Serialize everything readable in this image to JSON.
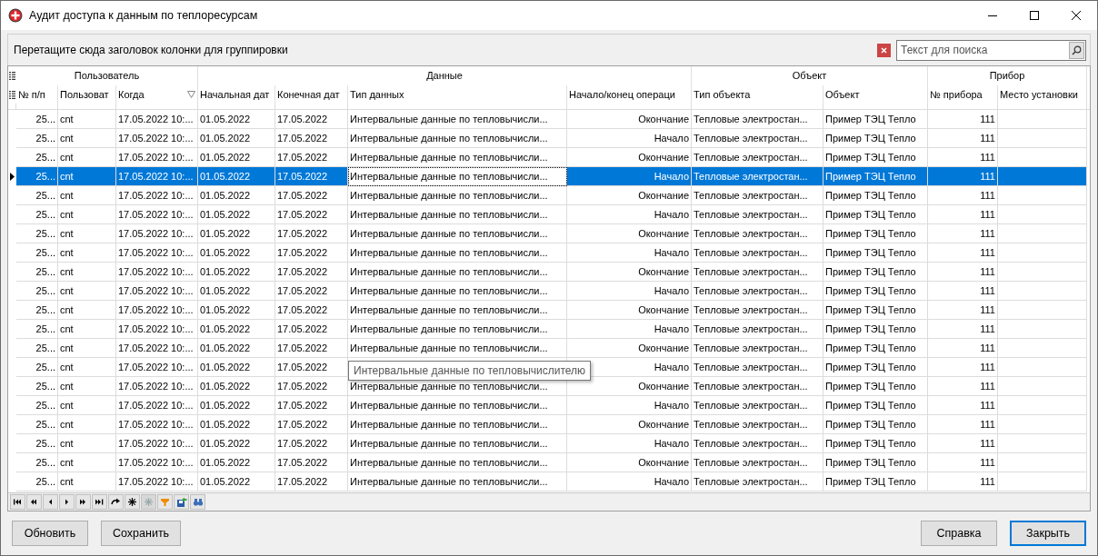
{
  "window": {
    "title": "Аудит доступа к данным по теплоресурсам"
  },
  "group_panel": {
    "hint": "Перетащите сюда заголовок колонки для группировки",
    "search": {
      "placeholder": "Текст для поиска"
    }
  },
  "table": {
    "bands": [
      {
        "label": "Пользователь",
        "columns": [
          {
            "label": "№ п/п",
            "filtered": false
          },
          {
            "label": "Пользоват",
            "filtered": false
          },
          {
            "label": "Когда",
            "filtered": true
          }
        ]
      },
      {
        "label": "Данные",
        "columns": [
          {
            "label": "Начальная дат",
            "filtered": false
          },
          {
            "label": "Конечная дат",
            "filtered": false
          },
          {
            "label": "Тип данных",
            "filtered": false
          },
          {
            "label": "Начало/конец операци",
            "filtered": false
          }
        ]
      },
      {
        "label": "Объект",
        "columns": [
          {
            "label": "Тип объекта",
            "filtered": false
          },
          {
            "label": "Объект",
            "filtered": false
          }
        ]
      },
      {
        "label": "Прибор",
        "columns": [
          {
            "label": "№ прибора",
            "filtered": false
          },
          {
            "label": "Место установки",
            "filtered": false
          }
        ]
      }
    ],
    "rows": [
      {
        "selected": false,
        "num": "25...",
        "user": "cnt",
        "when": "17.05.2022 10:...",
        "start": "01.05.2022",
        "end": "17.05.2022",
        "data_type": "Интервальные данные по тепловычисли...",
        "operation": "Окончание",
        "object_type": "Тепловые электростан...",
        "object": "Пример ТЭЦ Тепло",
        "device": "111"
      },
      {
        "selected": false,
        "num": "25...",
        "user": "cnt",
        "when": "17.05.2022 10:...",
        "start": "01.05.2022",
        "end": "17.05.2022",
        "data_type": "Интервальные данные по тепловычисли...",
        "operation": "Начало",
        "object_type": "Тепловые электростан...",
        "object": "Пример ТЭЦ Тепло",
        "device": "111"
      },
      {
        "selected": false,
        "num": "25...",
        "user": "cnt",
        "when": "17.05.2022 10:...",
        "start": "01.05.2022",
        "end": "17.05.2022",
        "data_type": "Интервальные данные по тепловычисли...",
        "operation": "Окончание",
        "object_type": "Тепловые электростан...",
        "object": "Пример ТЭЦ Тепло",
        "device": "111"
      },
      {
        "selected": true,
        "num": "25...",
        "user": "cnt",
        "when": "17.05.2022 10:...",
        "start": "01.05.2022",
        "end": "17.05.2022",
        "data_type": "Интервальные данные по тепловычисли...",
        "operation": "Начало",
        "object_type": "Тепловые электростан...",
        "object": "Пример ТЭЦ Тепло",
        "device": "111"
      },
      {
        "selected": false,
        "num": "25...",
        "user": "cnt",
        "when": "17.05.2022 10:...",
        "start": "01.05.2022",
        "end": "17.05.2022",
        "data_type": "Интервальные данные по тепловычисли...",
        "operation": "Окончание",
        "object_type": "Тепловые электростан...",
        "object": "Пример ТЭЦ Тепло",
        "device": "111"
      },
      {
        "selected": false,
        "num": "25...",
        "user": "cnt",
        "when": "17.05.2022 10:...",
        "start": "01.05.2022",
        "end": "17.05.2022",
        "data_type": "Интервальные данные по тепловычисли...",
        "operation": "Начало",
        "object_type": "Тепловые электростан...",
        "object": "Пример ТЭЦ Тепло",
        "device": "111"
      },
      {
        "selected": false,
        "num": "25...",
        "user": "cnt",
        "when": "17.05.2022 10:...",
        "start": "01.05.2022",
        "end": "17.05.2022",
        "data_type": "Интервальные данные по тепловычисли...",
        "operation": "Окончание",
        "object_type": "Тепловые электростан...",
        "object": "Пример ТЭЦ Тепло",
        "device": "111"
      },
      {
        "selected": false,
        "num": "25...",
        "user": "cnt",
        "when": "17.05.2022 10:...",
        "start": "01.05.2022",
        "end": "17.05.2022",
        "data_type": "Интервальные данные по тепловычисли...",
        "operation": "Начало",
        "object_type": "Тепловые электростан...",
        "object": "Пример ТЭЦ Тепло",
        "device": "111"
      },
      {
        "selected": false,
        "num": "25...",
        "user": "cnt",
        "when": "17.05.2022 10:...",
        "start": "01.05.2022",
        "end": "17.05.2022",
        "data_type": "Интервальные данные по тепловычисли...",
        "operation": "Окончание",
        "object_type": "Тепловые электростан...",
        "object": "Пример ТЭЦ Тепло",
        "device": "111"
      },
      {
        "selected": false,
        "num": "25...",
        "user": "cnt",
        "when": "17.05.2022 10:...",
        "start": "01.05.2022",
        "end": "17.05.2022",
        "data_type": "Интервальные данные по тепловычисли...",
        "operation": "Начало",
        "object_type": "Тепловые электростан...",
        "object": "Пример ТЭЦ Тепло",
        "device": "111"
      },
      {
        "selected": false,
        "num": "25...",
        "user": "cnt",
        "when": "17.05.2022 10:...",
        "start": "01.05.2022",
        "end": "17.05.2022",
        "data_type": "Интервальные данные по тепловычисли...",
        "operation": "Окончание",
        "object_type": "Тепловые электростан...",
        "object": "Пример ТЭЦ Тепло",
        "device": "111"
      },
      {
        "selected": false,
        "num": "25...",
        "user": "cnt",
        "when": "17.05.2022 10:...",
        "start": "01.05.2022",
        "end": "17.05.2022",
        "data_type": "Интервальные данные по тепловычисли...",
        "operation": "Начало",
        "object_type": "Тепловые электростан...",
        "object": "Пример ТЭЦ Тепло",
        "device": "111"
      },
      {
        "selected": false,
        "num": "25...",
        "user": "cnt",
        "when": "17.05.2022 10:...",
        "start": "01.05.2022",
        "end": "17.05.2022",
        "data_type": "Интервальные данные по тепловычисли...",
        "operation": "Окончание",
        "object_type": "Тепловые электростан...",
        "object": "Пример ТЭЦ Тепло",
        "device": "111"
      },
      {
        "selected": false,
        "num": "25...",
        "user": "cnt",
        "when": "17.05.2022 10:...",
        "start": "01.05.2022",
        "end": "17.05.2022",
        "operation": "Начало",
        "object_type": "Тепловые электростан...",
        "object": "Пример ТЭЦ Тепло",
        "device": "111"
      },
      {
        "selected": false,
        "num": "25...",
        "user": "cnt",
        "when": "17.05.2022 10:...",
        "start": "01.05.2022",
        "end": "17.05.2022",
        "data_type": "Интервальные данные по тепловычисли...",
        "operation": "Окончание",
        "object_type": "Тепловые электростан...",
        "object": "Пример ТЭЦ Тепло",
        "device": "111"
      },
      {
        "selected": false,
        "num": "25...",
        "user": "cnt",
        "when": "17.05.2022 10:...",
        "start": "01.05.2022",
        "end": "17.05.2022",
        "data_type": "Интервальные данные по тепловычисли...",
        "operation": "Начало",
        "object_type": "Тепловые электростан...",
        "object": "Пример ТЭЦ Тепло",
        "device": "111"
      },
      {
        "selected": false,
        "num": "25...",
        "user": "cnt",
        "when": "17.05.2022 10:...",
        "start": "01.05.2022",
        "end": "17.05.2022",
        "data_type": "Интервальные данные по тепловычисли...",
        "operation": "Окончание",
        "object_type": "Тепловые электростан...",
        "object": "Пример ТЭЦ Тепло",
        "device": "111"
      },
      {
        "selected": false,
        "num": "25...",
        "user": "cnt",
        "when": "17.05.2022 10:...",
        "start": "01.05.2022",
        "end": "17.05.2022",
        "data_type": "Интервальные данные по тепловычисли...",
        "operation": "Начало",
        "object_type": "Тепловые электростан...",
        "object": "Пример ТЭЦ Тепло",
        "device": "111"
      },
      {
        "selected": false,
        "num": "25...",
        "user": "cnt",
        "when": "17.05.2022 10:...",
        "start": "01.05.2022",
        "end": "17.05.2022",
        "data_type": "Интервальные данные по тепловычисли...",
        "operation": "Окончание",
        "object_type": "Тепловые электростан...",
        "object": "Пример ТЭЦ Тепло",
        "device": "111"
      },
      {
        "selected": false,
        "num": "25...",
        "user": "cnt",
        "when": "17.05.2022 10:...",
        "start": "01.05.2022",
        "end": "17.05.2022",
        "data_type": "Интервальные данные по тепловычисли...",
        "operation": "Начало",
        "object_type": "Тепловые электростан...",
        "object": "Пример ТЭЦ Тепло",
        "device": "111"
      }
    ],
    "tooltip": "Интервальные данные по тепловычислителю"
  },
  "navigator": [
    {
      "kind": "first",
      "disabled": false
    },
    {
      "kind": "prev_page",
      "disabled": false
    },
    {
      "kind": "prev",
      "disabled": false
    },
    {
      "kind": "next",
      "disabled": false
    },
    {
      "kind": "next_page",
      "disabled": false
    },
    {
      "kind": "last",
      "disabled": false
    },
    {
      "kind": "refresh",
      "disabled": false
    },
    {
      "kind": "insert",
      "disabled": false
    },
    {
      "kind": "delete",
      "disabled": true
    },
    {
      "kind": "filter",
      "disabled": false
    },
    {
      "kind": "export",
      "disabled": false
    },
    {
      "kind": "find",
      "disabled": false
    }
  ],
  "buttons_left": [
    "Обновить",
    "Сохранить"
  ],
  "buttons_right": [
    {
      "label": "Справка",
      "default": false
    },
    {
      "label": "Закрыть",
      "default": true
    }
  ]
}
